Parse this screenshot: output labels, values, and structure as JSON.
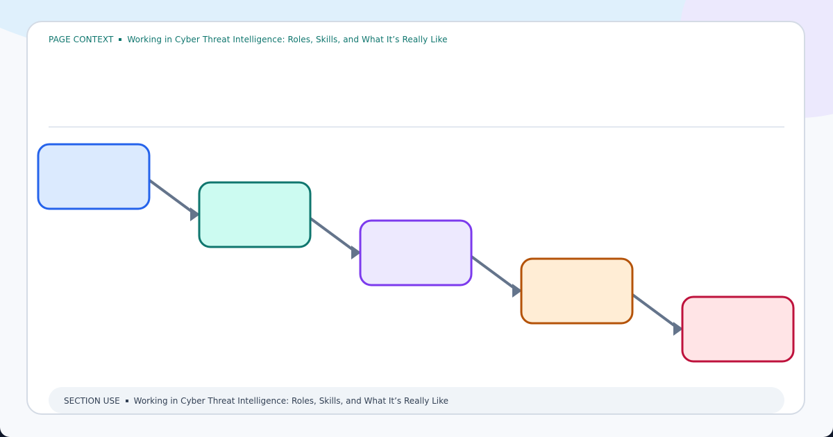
{
  "header": {
    "label": "PAGE CONTEXT",
    "title": "Working in Cyber Threat Intelligence: Roles, Skills, and What It’s Really Like"
  },
  "footer": {
    "label": "SECTION USE",
    "title": "Working in Cyber Threat Intelligence: Roles, Skills, and What It’s Really Like"
  },
  "diagram": {
    "nodes": [
      {
        "id": "step-1",
        "fill": "#dbeafe",
        "stroke": "#2563eb"
      },
      {
        "id": "step-2",
        "fill": "#ccfbf1",
        "stroke": "#0f766e"
      },
      {
        "id": "step-3",
        "fill": "#ede9fe",
        "stroke": "#7c3aed"
      },
      {
        "id": "step-4",
        "fill": "#ffedd5",
        "stroke": "#b45309"
      },
      {
        "id": "step-5",
        "fill": "#ffe4e6",
        "stroke": "#be123c"
      }
    ],
    "connector_color": "#64748b"
  }
}
